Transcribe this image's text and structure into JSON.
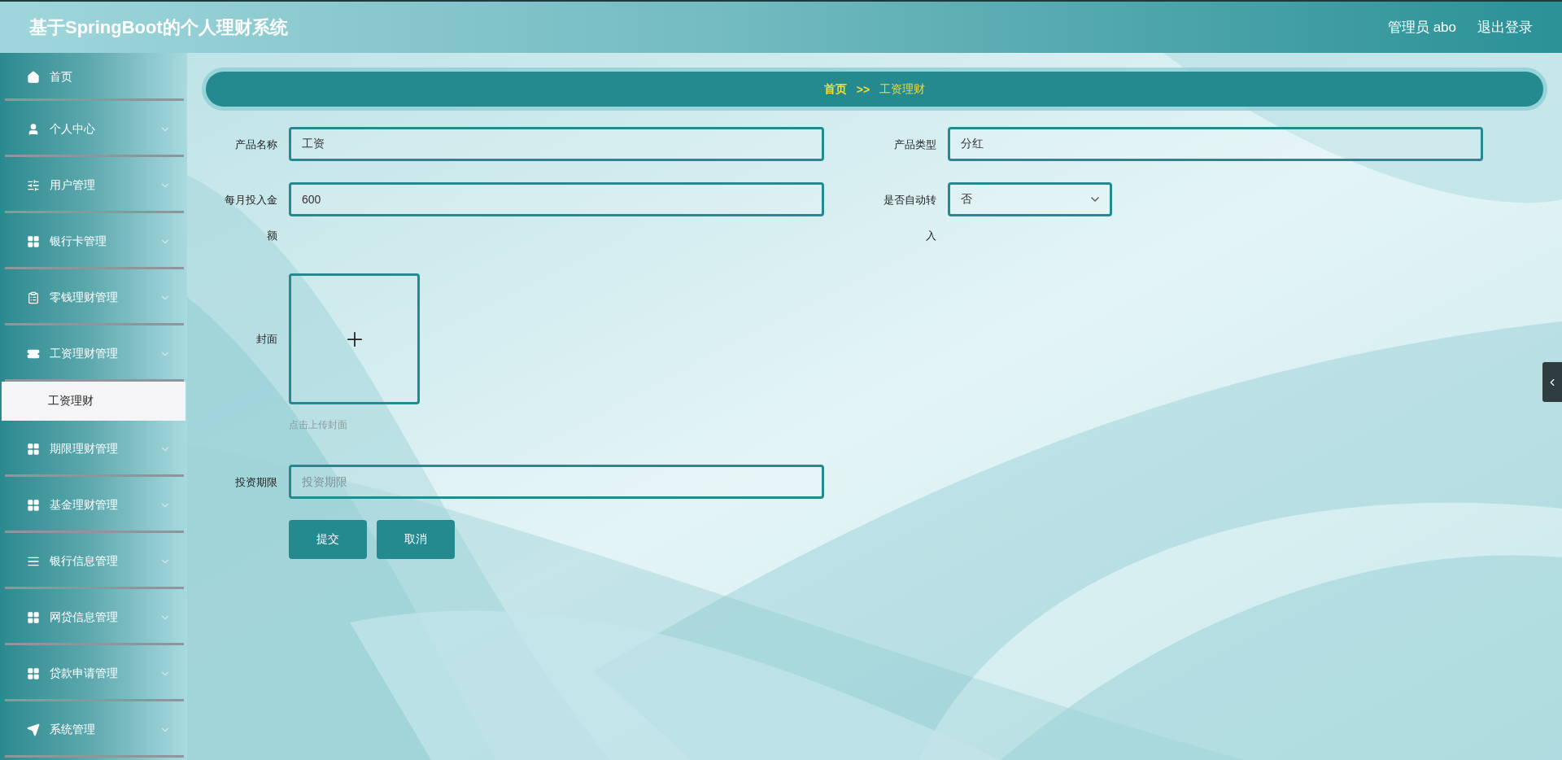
{
  "header": {
    "title": "基于SpringBoot的个人理财系统",
    "user": "管理员 abo",
    "logout": "退出登录"
  },
  "sidebar": {
    "items": [
      {
        "kind": "home",
        "label": "首页",
        "expandable": false,
        "selected": false
      },
      {
        "kind": "user",
        "label": "个人中心",
        "expandable": true,
        "selected": false
      },
      {
        "kind": "sliders",
        "label": "用户管理",
        "expandable": true,
        "selected": false
      },
      {
        "kind": "grid",
        "label": "银行卡管理",
        "expandable": true,
        "selected": false
      },
      {
        "kind": "clipboard",
        "label": "零钱理财管理",
        "expandable": true,
        "selected": false
      },
      {
        "kind": "ticket",
        "label": "工资理财管理",
        "expandable": true,
        "expanded": true,
        "selected": false,
        "children": [
          {
            "label": "工资理财",
            "selected": true
          }
        ]
      },
      {
        "kind": "grid",
        "label": "期限理财管理",
        "expandable": true,
        "selected": false
      },
      {
        "kind": "grid",
        "label": "基金理财管理",
        "expandable": true,
        "selected": false
      },
      {
        "kind": "list",
        "label": "银行信息管理",
        "expandable": true,
        "selected": false
      },
      {
        "kind": "grid",
        "label": "网贷信息管理",
        "expandable": true,
        "selected": false
      },
      {
        "kind": "grid",
        "label": "贷款申请管理",
        "expandable": true,
        "selected": false
      },
      {
        "kind": "send",
        "label": "系统管理",
        "expandable": true,
        "selected": false
      }
    ]
  },
  "breadcrumb": {
    "items": [
      "首页",
      "工资理财"
    ],
    "separator": ">>"
  },
  "form": {
    "fields": [
      {
        "kind": "text",
        "label": "产品名称",
        "value": "工资"
      },
      {
        "kind": "text",
        "label": "产品类型",
        "value": "分红"
      },
      {
        "kind": "text",
        "label": "每月投入金额",
        "value": "600"
      },
      {
        "kind": "select",
        "label": "是否自动转入",
        "value": "否"
      },
      {
        "kind": "upload",
        "label": "封面",
        "hint": "点击上传封面"
      },
      {
        "kind": "text",
        "label": "投资期限",
        "placeholder": "投资期限"
      }
    ],
    "buttons": [
      "提交",
      "取消"
    ]
  }
}
